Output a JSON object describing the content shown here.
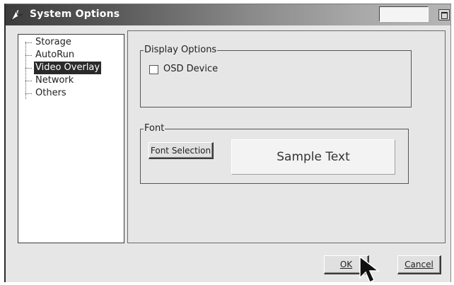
{
  "window": {
    "title": "System Options"
  },
  "tree": {
    "items": [
      {
        "label": "Storage",
        "selected": false
      },
      {
        "label": "AutoRun",
        "selected": false
      },
      {
        "label": "Video Overlay",
        "selected": true
      },
      {
        "label": "Network",
        "selected": false
      },
      {
        "label": "Others",
        "selected": false
      }
    ]
  },
  "display_options": {
    "legend": "Display Options",
    "osd_device_label": "OSD Device",
    "osd_device_checked": false
  },
  "font": {
    "legend": "Font",
    "font_selection_label": "Font Selection",
    "sample_text": "Sample Text"
  },
  "footer": {
    "ok_label": "OK",
    "cancel_label": "Cancel"
  }
}
